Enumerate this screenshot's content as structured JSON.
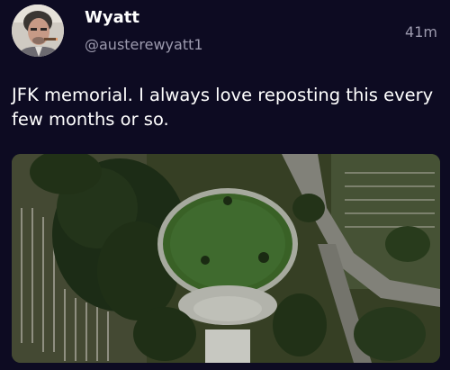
{
  "post": {
    "author": {
      "display_name": "Wyatt",
      "handle": "@austerewyatt1",
      "avatar": "avatar-man-with-cigar"
    },
    "timestamp": "41m",
    "text": "JFK memorial. I always love reposting this every few months or so.",
    "media": {
      "type": "aerial-photo",
      "subject": "jfk-memorial-aerial"
    }
  },
  "colors": {
    "background": "#0d0b22",
    "text_primary": "#ffffff",
    "text_secondary": "#9c9aae"
  }
}
